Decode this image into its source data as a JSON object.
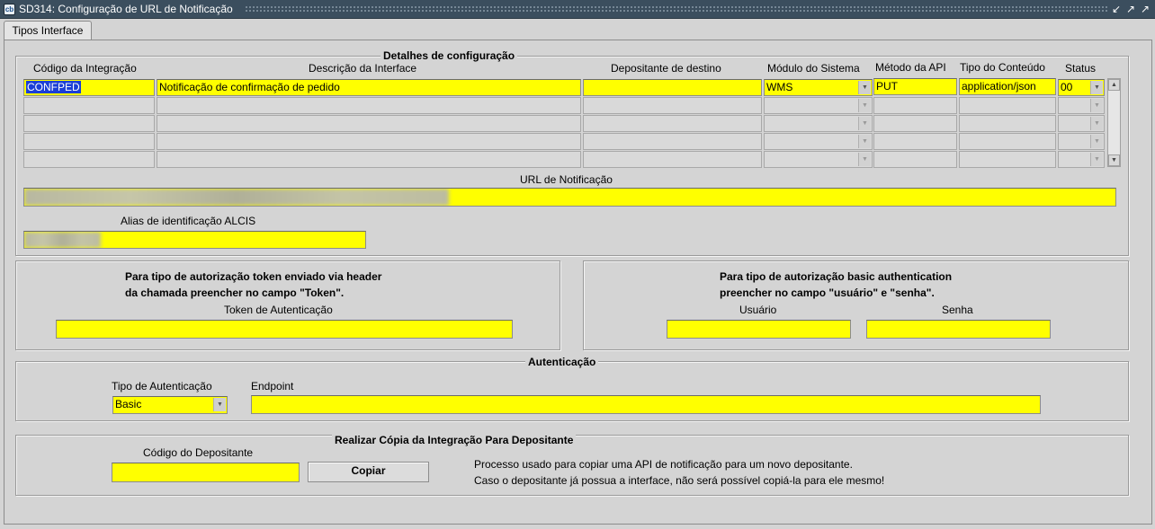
{
  "window": {
    "title": "SD314: Configuração de URL de Notificação",
    "icon_label": "cb"
  },
  "tabs": [
    {
      "label": "Tipos Interface"
    }
  ],
  "details": {
    "title": "Detalhes de configuração",
    "columns": [
      "Código da Integração",
      "Descrição da Interface",
      "Depositante de destino",
      "Módulo do Sistema",
      "Método da API",
      "Tipo do Conteúdo",
      "Status"
    ],
    "rows": [
      {
        "codigo": "CONFPED",
        "descricao": "Notificação de confirmação de pedido",
        "depositante": "",
        "modulo": "WMS",
        "metodo": "PUT",
        "tipo": "application/json",
        "status": "00"
      },
      {
        "codigo": "",
        "descricao": "",
        "depositante": "",
        "modulo": "",
        "metodo": "",
        "tipo": "",
        "status": ""
      },
      {
        "codigo": "",
        "descricao": "",
        "depositante": "",
        "modulo": "",
        "metodo": "",
        "tipo": "",
        "status": ""
      },
      {
        "codigo": "",
        "descricao": "",
        "depositante": "",
        "modulo": "",
        "metodo": "",
        "tipo": "",
        "status": ""
      },
      {
        "codigo": "",
        "descricao": "",
        "depositante": "",
        "modulo": "",
        "metodo": "",
        "tipo": "",
        "status": ""
      }
    ],
    "url_label": "URL de Notificação",
    "alias_label": "Alias de identificação ALCIS"
  },
  "token_panel": {
    "line1": "Para tipo de autorização token enviado via header",
    "line2": "da chamada preencher no campo \"Token\".",
    "token_label": "Token de Autenticação",
    "token_value": ""
  },
  "basic_panel": {
    "line1": "Para tipo de autorização basic authentication",
    "line2": "preencher no campo \"usuário\" e \"senha\".",
    "user_label": "Usuário",
    "pass_label": "Senha",
    "user_value": "",
    "pass_value": ""
  },
  "auth": {
    "title": "Autenticação",
    "type_label": "Tipo de Autenticação",
    "type_value": "Basic",
    "endpoint_label": "Endpoint",
    "endpoint_value": ""
  },
  "copy": {
    "title": "Realizar Cópia da Integração Para Depositante",
    "code_label": "Código do Depositante",
    "code_value": "",
    "button_label": "Copiar",
    "info_line1": "Processo usado para copiar uma API de notificação para um novo depositante.",
    "info_line2": "Caso o depositante já possua a interface, não será possível copiá-la para ele mesmo!"
  },
  "colors": {
    "field": "#ffff00",
    "titlebar": "#3b4e5e",
    "selection": "#1b3fd6"
  },
  "icons": {
    "app": "oracle-forms-icon",
    "minimize": "minimize-icon",
    "maximize": "maximize-icon"
  }
}
